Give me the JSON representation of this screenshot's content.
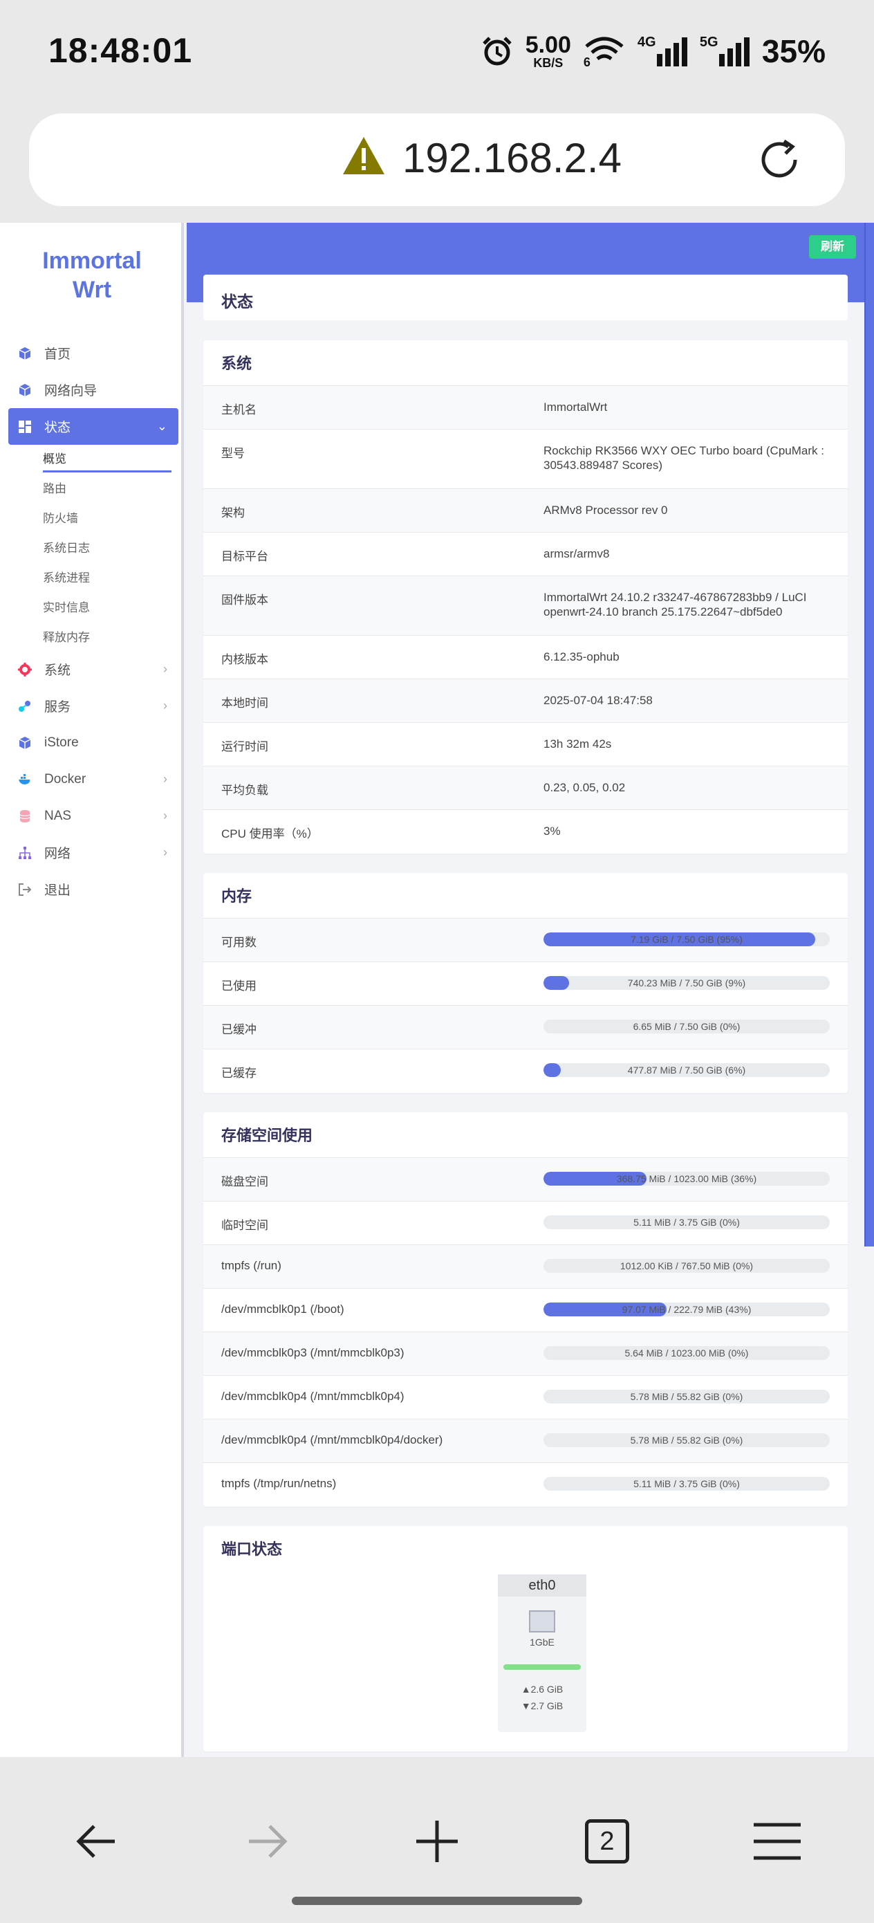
{
  "status_bar": {
    "time": "18:48:01",
    "net_speed_value": "5.00",
    "net_speed_unit": "KB/S",
    "wifi_label": "6",
    "sim1_label": "4G",
    "sim2_label": "5G",
    "battery": "35%"
  },
  "browser": {
    "url": "192.168.2.4",
    "tab_count": "2"
  },
  "sidebar": {
    "logo_line1": "Immortal",
    "logo_line2": "Wrt",
    "items": [
      {
        "label": "首页",
        "icon": "cube-icon"
      },
      {
        "label": "网络向导",
        "icon": "cube-icon"
      },
      {
        "label": "状态",
        "icon": "dashboard-icon"
      },
      {
        "label": "系统",
        "icon": "gear-icon"
      },
      {
        "label": "服务",
        "icon": "nodes-icon"
      },
      {
        "label": "iStore",
        "icon": "cube-icon"
      },
      {
        "label": "Docker",
        "icon": "docker-icon"
      },
      {
        "label": "NAS",
        "icon": "database-icon"
      },
      {
        "label": "网络",
        "icon": "sitemap-icon"
      },
      {
        "label": "退出",
        "icon": "logout-icon"
      }
    ],
    "status_sub": [
      "概览",
      "路由",
      "防火墙",
      "系统日志",
      "系统进程",
      "实时信息",
      "释放内存"
    ]
  },
  "header": {
    "refresh_label": "刷新",
    "page_title": "状态"
  },
  "system": {
    "title": "系统",
    "rows": [
      {
        "key": "主机名",
        "value": "ImmortalWrt"
      },
      {
        "key": "型号",
        "value": "Rockchip RK3566 WXY OEC Turbo board (CpuMark : 30543.889487 Scores)"
      },
      {
        "key": "架构",
        "value": "ARMv8 Processor rev 0"
      },
      {
        "key": "目标平台",
        "value": "armsr/armv8"
      },
      {
        "key": "固件版本",
        "value": "ImmortalWrt 24.10.2 r33247-467867283bb9 / LuCI openwrt-24.10 branch 25.175.22647~dbf5de0"
      },
      {
        "key": "内核版本",
        "value": "6.12.35-ophub"
      },
      {
        "key": "本地时间",
        "value": "2025-07-04 18:47:58"
      },
      {
        "key": "运行时间",
        "value": "13h 32m 42s"
      },
      {
        "key": "平均负载",
        "value": "0.23, 0.05, 0.02"
      },
      {
        "key": "CPU 使用率（%）",
        "value": "3%"
      }
    ]
  },
  "memory": {
    "title": "内存",
    "rows": [
      {
        "key": "可用数",
        "text": "7.19 GiB / 7.50 GiB (95%)",
        "percent": 95
      },
      {
        "key": "已使用",
        "text": "740.23 MiB / 7.50 GiB (9%)",
        "percent": 9
      },
      {
        "key": "已缓冲",
        "text": "6.65 MiB / 7.50 GiB (0%)",
        "percent": 0
      },
      {
        "key": "已缓存",
        "text": "477.87 MiB / 7.50 GiB (6%)",
        "percent": 6
      }
    ]
  },
  "storage": {
    "title": "存储空间使用",
    "rows": [
      {
        "key": "磁盘空间",
        "text": "368.75 MiB / 1023.00 MiB (36%)",
        "percent": 36
      },
      {
        "key": "临时空间",
        "text": "5.11 MiB / 3.75 GiB (0%)",
        "percent": 0
      },
      {
        "key": "tmpfs (/run)",
        "text": "1012.00 KiB / 767.50 MiB (0%)",
        "percent": 0
      },
      {
        "key": "/dev/mmcblk0p1 (/boot)",
        "text": "97.07 MiB / 222.79 MiB (43%)",
        "percent": 43
      },
      {
        "key": "/dev/mmcblk0p3 (/mnt/mmcblk0p3)",
        "text": "5.64 MiB / 1023.00 MiB (0%)",
        "percent": 0
      },
      {
        "key": "/dev/mmcblk0p4 (/mnt/mmcblk0p4)",
        "text": "5.78 MiB / 55.82 GiB (0%)",
        "percent": 0
      },
      {
        "key": "/dev/mmcblk0p4 (/mnt/mmcblk0p4/docker)",
        "text": "5.78 MiB / 55.82 GiB (0%)",
        "percent": 0
      },
      {
        "key": "tmpfs (/tmp/run/netns)",
        "text": "5.11 MiB / 3.75 GiB (0%)",
        "percent": 0
      }
    ]
  },
  "ports": {
    "title": "端口状态",
    "name": "eth0",
    "speed": "1GbE",
    "tx": "▲2.6 GiB",
    "rx": "▼2.7 GiB"
  },
  "colors": {
    "accent": "#5e72e4",
    "success": "#2dce89"
  }
}
